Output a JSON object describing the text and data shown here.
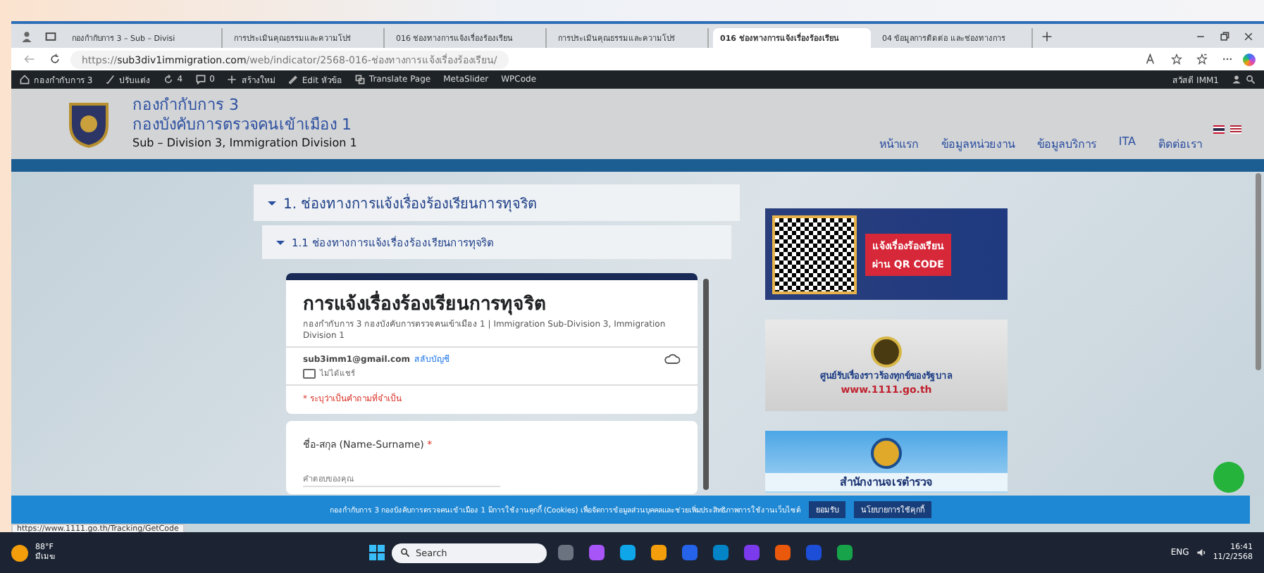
{
  "browser": {
    "tabs": [
      {
        "title": "กองกำกับการ 3 – Sub – Divisi",
        "selected": false
      },
      {
        "title": "การประเมินคุณธรรมและความโปร่",
        "selected": false
      },
      {
        "title": "016 ช่องทางการแจ้งเรื่องร้องเรียน",
        "selected": false
      },
      {
        "title": "การประเมินคุณธรรมและความโปร่",
        "selected": false
      },
      {
        "title": "016 ช่องทางการแจ้งเรื่องร้องเรียน",
        "selected": true
      },
      {
        "title": "04 ข้อมูลการติดต่อ และช่องทางการ",
        "selected": false
      }
    ],
    "address": {
      "prefix": "https://",
      "domain": "sub3div1immigration.com",
      "path": "/web/indicator/2568-016-ช่องทางการแจ้งเรื่องร้องเรียน/"
    },
    "status_url": "https://www.1111.go.th/Tracking/GetCode"
  },
  "admin_bar": {
    "items": [
      {
        "kind": "site",
        "label": "กองกำกับการ 3"
      },
      {
        "kind": "customize",
        "label": "ปรับแต่ง"
      },
      {
        "kind": "updates",
        "label": "4"
      },
      {
        "kind": "comments",
        "label": "0"
      },
      {
        "kind": "new",
        "label": "สร้างใหม่"
      },
      {
        "kind": "edit",
        "label": "Edit หัวข้อ"
      },
      {
        "kind": "translate",
        "label": "Translate Page"
      },
      {
        "kind": "plain",
        "label": "MetaSlider"
      },
      {
        "kind": "plain",
        "label": "WPCode"
      }
    ],
    "greeting": "สวัสดี IMM1"
  },
  "site_header": {
    "title_1": "กองกำกับการ 3",
    "title_2": "กองบังคับการตรวจคนเข้าเมือง 1",
    "subtitle": "Sub – Division 3, Immigration Division 1",
    "nav": [
      "หน้าแรก",
      "ข้อมูลหน่วยงาน",
      "ข้อมูลบริการ",
      "ITA",
      "ติดต่อเรา"
    ]
  },
  "accordion": {
    "title": "1. ช่องทางการแจ้งเรื่องร้องเรียนการทุจริต",
    "expanded": true,
    "sub": {
      "title": "1.1 ช่องทางการแจ้งเรื่องร้องเรียนการทุจริต",
      "expanded": true
    }
  },
  "form": {
    "title": "การแจ้งเรื่องร้องเรียนการทุจริต",
    "description": "กองกำกับการ 3 กองบังคับการตรวจคนเข้าเมือง 1 | Immigration Sub-Division 3, Immigration Division 1",
    "email": "sub3imm1@gmail.com",
    "switch_account": "สลับบัญชี",
    "not_shared": "ไม่ได้แชร์",
    "required_note": "* ระบุว่าเป็นคำถามที่จำเป็น",
    "question": "ชื่อ-สกุล (Name-Surname)",
    "required_mark": "*",
    "placeholder": "คำตอบของคุณ"
  },
  "banners": [
    {
      "kind": "qr",
      "line_1": "แจ้งเรื่องร้องเรียน",
      "line_2": "ผ่าน QR CODE"
    },
    {
      "kind": "gov",
      "line_1": "ศูนย์รับเรื่องราวร้องทุกข์ของรัฐบาล",
      "line_2": "www.1111.go.th"
    },
    {
      "kind": "police",
      "line_1": "สำนักงานจเรตำรวจ"
    }
  ],
  "cookie_bar": {
    "text": "กองกำกับการ 3 กองบังคับการตรวจคนเข้าเมือง 1 มีการใช้งานคุกกี้ (Cookies) เพื่อจัดการข้อมูลส่วนบุคคลและช่วยเพิ่มประสิทธิภาพการใช้งานเว็บไซต์",
    "buttons": [
      "ยอมรับ",
      "นโยบายการใช้คุกกี้"
    ]
  },
  "taskbar": {
    "weather": "88°F",
    "weather_note": "มีเมฆ",
    "search": "Search",
    "lang": "ENG",
    "time": "16:41",
    "date": "11/2/2568"
  }
}
